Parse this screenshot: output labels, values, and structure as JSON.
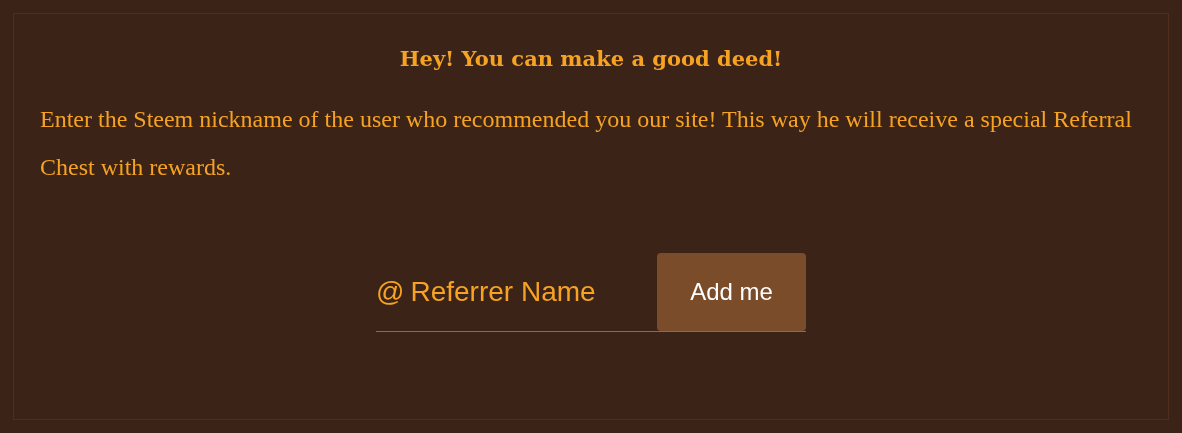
{
  "heading": "Hey! You can make a good deed!",
  "description": "Enter the Steem nickname of the user who recommended you our site! This way he will receive a special Referral Chest with rewards.",
  "referrer_field": {
    "prefix": "@",
    "placeholder": "Referrer Name"
  },
  "submit_button": "Add me"
}
